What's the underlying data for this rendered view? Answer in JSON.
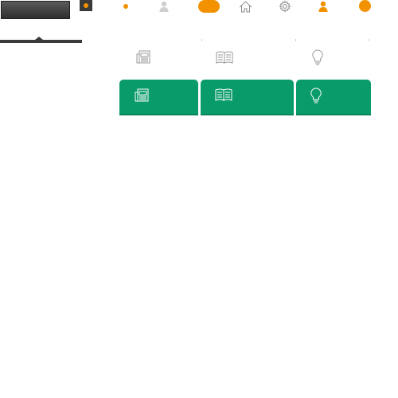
{
  "header": {
    "icons": [
      "user-icon",
      "home-icon",
      "gear-icon",
      "user-icon"
    ],
    "status_indicator": "orange",
    "notification_badge": "orange"
  },
  "categories": [
    {
      "name": "news",
      "icon": "newspaper-icon"
    },
    {
      "name": "magazine",
      "icon": "open-book-icon"
    },
    {
      "name": "ideas",
      "icon": "lightbulb-icon"
    }
  ],
  "colors": {
    "accent": "#f39200",
    "tile_green": "#0a9b6a",
    "dark": "#3a3a3a"
  }
}
